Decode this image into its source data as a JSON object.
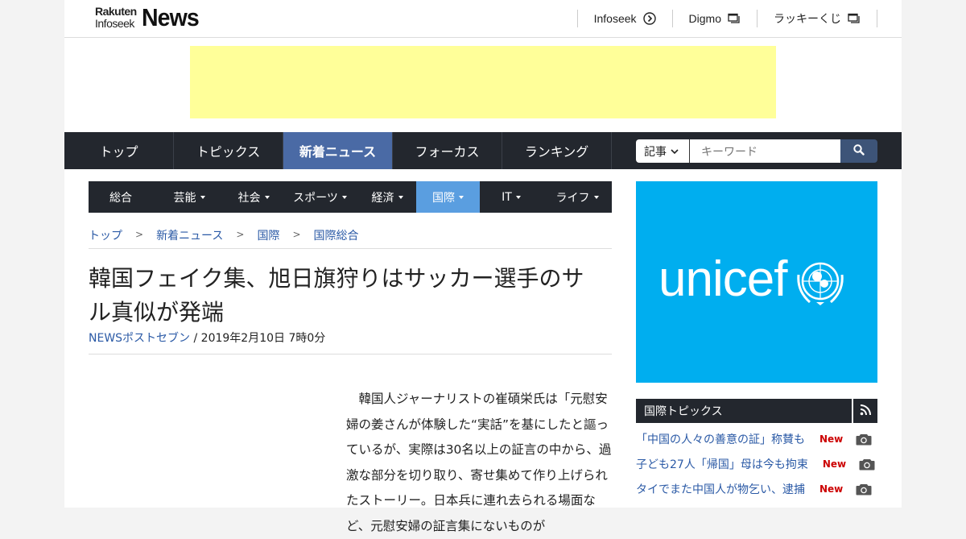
{
  "header": {
    "logo_small_1": "Rakuten",
    "logo_small_2": "Infoseek",
    "logo_big": "News",
    "links": [
      {
        "label": "Infoseek",
        "icon": "arrow-circle-icon"
      },
      {
        "label": "Digmo",
        "icon": "window-icon"
      },
      {
        "label": "ラッキーくじ",
        "icon": "window-icon"
      }
    ]
  },
  "ad": {
    "color": "#ffff99"
  },
  "main_nav": {
    "items": [
      "トップ",
      "トピックス",
      "新着ニュース",
      "フォーカス",
      "ランキング"
    ],
    "active": "新着ニュース"
  },
  "search": {
    "category": "記事",
    "placeholder": "キーワード",
    "icon": "search-icon"
  },
  "sub_nav": {
    "items": [
      {
        "label": "総合",
        "caret": false
      },
      {
        "label": "芸能",
        "caret": true
      },
      {
        "label": "社会",
        "caret": true
      },
      {
        "label": "スポーツ",
        "caret": true
      },
      {
        "label": "経済",
        "caret": true
      },
      {
        "label": "国際",
        "caret": true
      },
      {
        "label": "IT",
        "caret": true
      },
      {
        "label": "ライフ",
        "caret": true
      }
    ],
    "active": "国際"
  },
  "breadcrumb": [
    "トップ",
    "新着ニュース",
    "国際",
    "国際総合"
  ],
  "article": {
    "title": "韓国フェイク集、旭日旗狩りはサッカー選手のサル真似が発端",
    "source": "NEWSポストセブン",
    "date": " / 2019年2月10日 7時0分",
    "body": "　韓国人ジャーナリストの崔碩栄氏は「元慰安婦の姜さんが体験した“実話”を基にしたと謳っているが、実際は30名以上の証言の中から、過激な部分を切り取り、寄せ集めて作り上げられたストーリー。日本兵に連れ去られる場面など、元慰安婦の証言集にないものが"
  },
  "ad_right": {
    "text": "unicef",
    "color": "#00aeef"
  },
  "topics": {
    "heading": "国際トピックス",
    "items": [
      {
        "text": "「中国の人々の善意の証」称賛も",
        "badge": "New"
      },
      {
        "text": "子ども27人「帰国」母は今も拘束",
        "badge": "New"
      },
      {
        "text": "タイでまた中国人が物乞い、逮捕",
        "badge": "New"
      }
    ]
  },
  "colors": {
    "nav_bg": "#23272e",
    "nav_active": "#4a6aa5",
    "subnav_active": "#5a9ee0",
    "link": "#2b5aa6",
    "new_badge": "#cc0000"
  }
}
